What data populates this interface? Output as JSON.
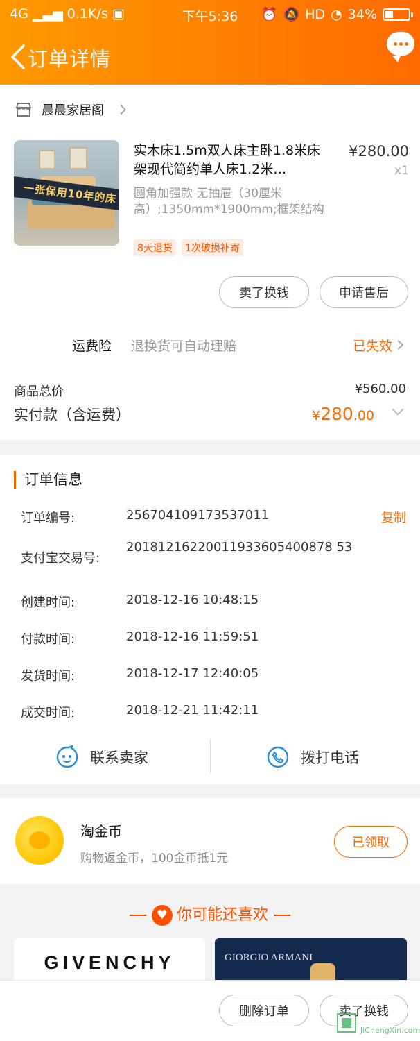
{
  "status_bar": {
    "network": "4G",
    "speed": "0.1K/s",
    "time": "下午5:36",
    "hd": "HD",
    "battery": "34%",
    "battery_level": 0.34
  },
  "nav": {
    "title": "订单详情"
  },
  "shop": {
    "name": "晨晨家居阁"
  },
  "product": {
    "image_banner": "一张保用10年的床",
    "title": "实木床1.5m双人床主卧1.8米床架现代简约单人床1.2米…",
    "sku": "圆角加强款 无抽屉（30厘米高）;1350mm*1900mm;框架结构",
    "price": "¥280.00",
    "qty": "x1",
    "tags": [
      "8天退货",
      "1次破损补寄"
    ],
    "btn_sell": "卖了换钱",
    "btn_after": "申请售后"
  },
  "insurance": {
    "label": "运费险",
    "desc": "退换货可自动理赔",
    "status": "已失效"
  },
  "totals": {
    "goods_label": "商品总价",
    "goods_value": "¥560.00",
    "paid_label": "实付款（含运费）",
    "paid_currency": "¥",
    "paid_int": "280",
    "paid_dec": ".00"
  },
  "order_info": {
    "title": "订单信息",
    "copy": "复制",
    "rows": [
      {
        "key": "订单编号:",
        "value": "256704109173537011"
      },
      {
        "key": "支付宝交易号:",
        "value": "20181216220011933605400878 53"
      },
      {
        "key": "创建时间:",
        "value": "2018-12-16 10:48:15"
      },
      {
        "key": "付款时间:",
        "value": "2018-12-16 11:59:51"
      },
      {
        "key": "发货时间:",
        "value": "2018-12-17 12:40:05"
      },
      {
        "key": "成交时间:",
        "value": "2018-12-21 11:42:11"
      }
    ],
    "contact_seller": "联系卖家",
    "call_phone": "拨打电话"
  },
  "coins": {
    "title": "淘金币",
    "subtitle": "购物返金币，100金币抵1元",
    "button": "已领取"
  },
  "recommend": {
    "title": "你可能还喜欢",
    "brand1": "GIVENCHY",
    "brand2": "GIORGIO ARMANI"
  },
  "bottom": {
    "delete": "删除订单",
    "sell": "卖了换钱"
  },
  "watermark": "JiChengXin.com",
  "colors": {
    "accent": "#ff6a00",
    "header_start": "#ff9a00",
    "header_end": "#ff6a00"
  }
}
